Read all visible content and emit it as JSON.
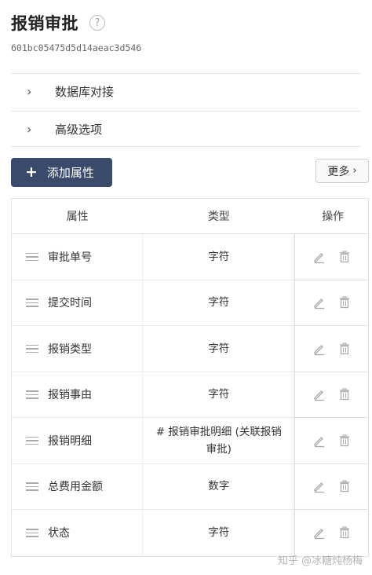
{
  "header": {
    "title": "报销审批",
    "help_glyph": "?",
    "id": "601bc05475d5d14aeac3d546"
  },
  "sections": [
    {
      "label": "数据库对接"
    },
    {
      "label": "高级选项"
    }
  ],
  "toolbar": {
    "add_label": "添加属性",
    "more_label": "更多"
  },
  "table": {
    "columns": [
      "属性",
      "类型",
      "操作"
    ],
    "rows": [
      {
        "name": "审批单号",
        "type": "字符"
      },
      {
        "name": "提交时间",
        "type": "字符"
      },
      {
        "name": "报销类型",
        "type": "字符"
      },
      {
        "name": "报销事由",
        "type": "字符"
      },
      {
        "name": "报销明细",
        "type": "# 报销审批明细 (关联报销审批)"
      },
      {
        "name": "总费用金额",
        "type": "数字"
      },
      {
        "name": "状态",
        "type": "字符"
      }
    ]
  },
  "watermark": "知乎 @冰糖炖杨梅",
  "colors": {
    "primary_button": "#3a4a6b",
    "icon_gray": "#aaaaaa"
  }
}
